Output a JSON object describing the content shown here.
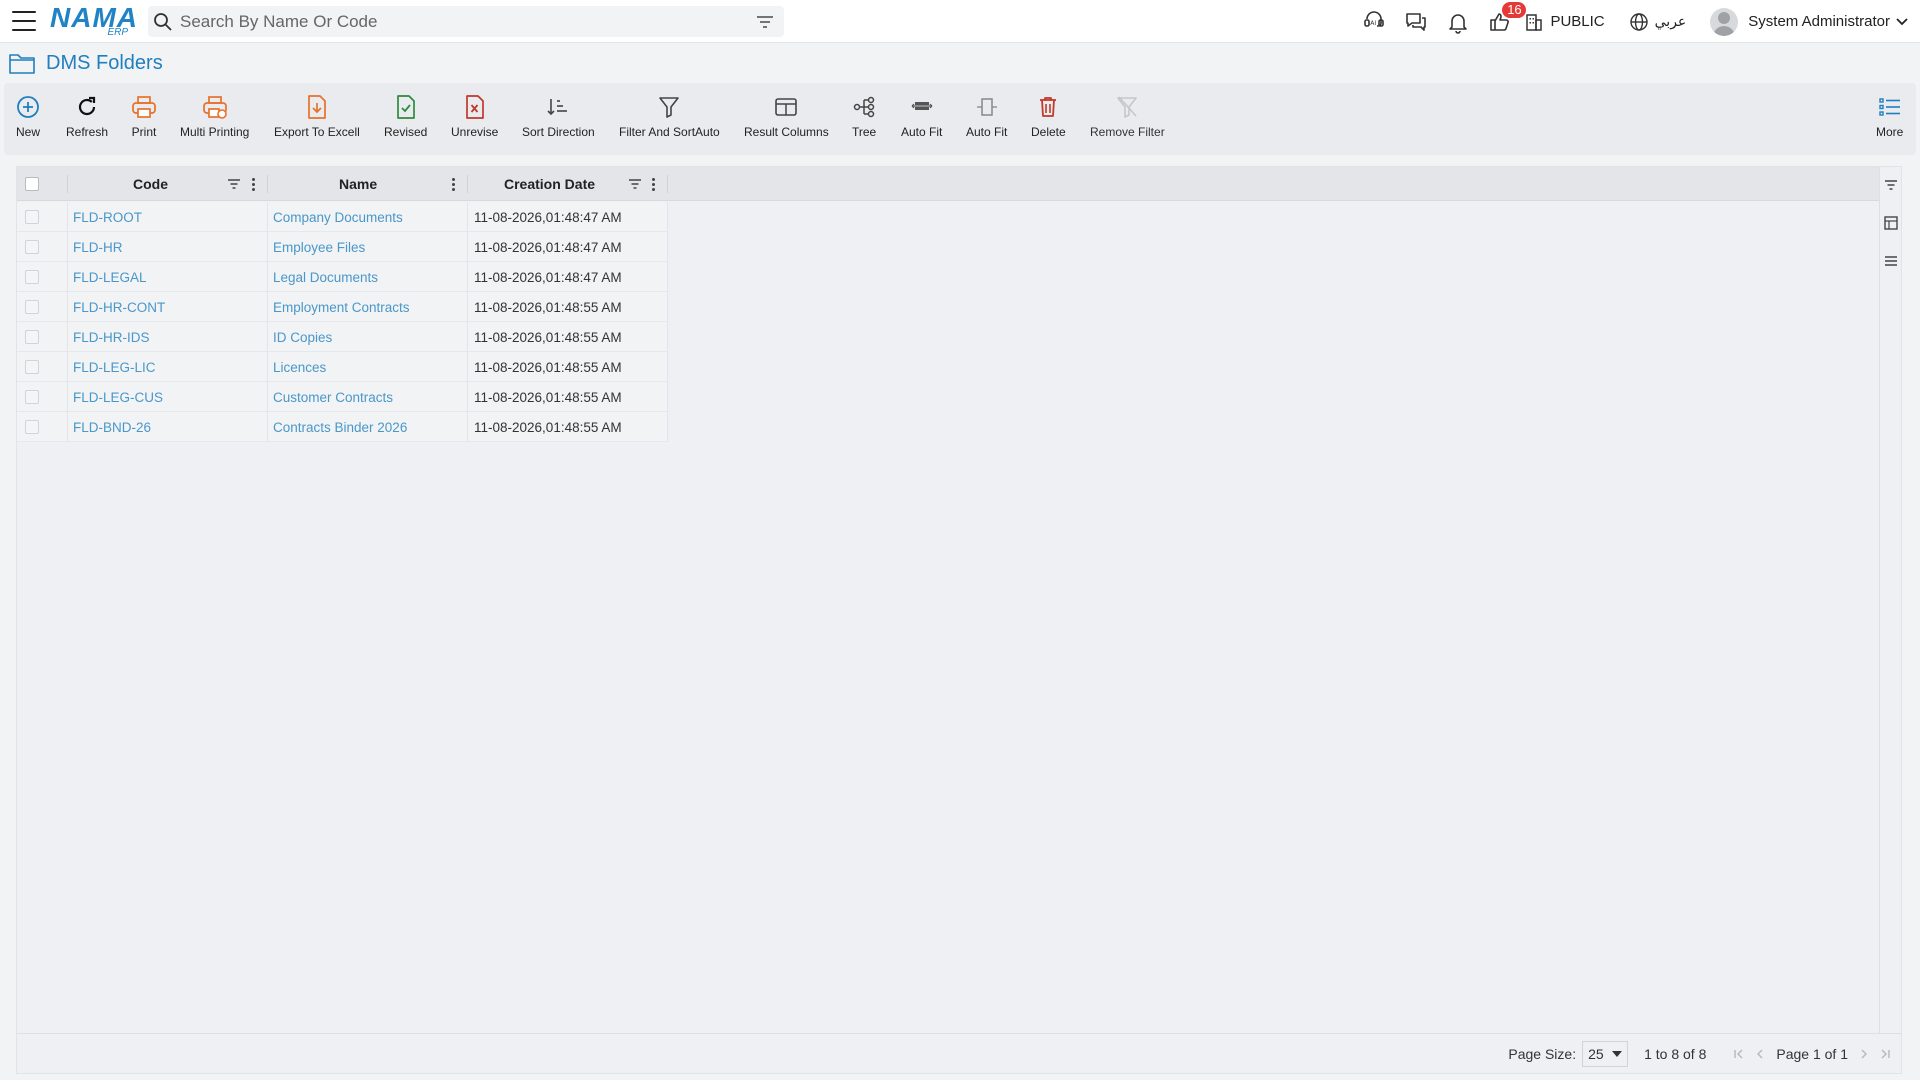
{
  "header": {
    "logo_main": "NAMA",
    "logo_sub": "ERP",
    "search_placeholder": "Search By Name Or Code",
    "notification_count": "16",
    "branch": "PUBLIC",
    "language": "عربي",
    "user_name": "System Administrator"
  },
  "page": {
    "title": "DMS Folders"
  },
  "toolbar": {
    "new": "New",
    "refresh": "Refresh",
    "print": "Print",
    "multi_printing": "Multi Printing",
    "export_excel": "Export To Excell",
    "revised": "Revised",
    "unrevise": "Unrevise",
    "sort_direction": "Sort Direction",
    "filter_sort_auto": "Filter And SortAuto",
    "result_columns": "Result Columns",
    "tree": "Tree",
    "auto_fit_1": "Auto Fit",
    "auto_fit_2": "Auto Fit",
    "delete": "Delete",
    "remove_filter": "Remove Filter",
    "more": "More"
  },
  "grid": {
    "columns": {
      "code": "Code",
      "name": "Name",
      "creation_date": "Creation Date"
    },
    "rows": [
      {
        "code": "FLD-ROOT",
        "name": "Company Documents",
        "date": "11-08-2026,01:48:47 AM"
      },
      {
        "code": "FLD-HR",
        "name": "Employee Files",
        "date": "11-08-2026,01:48:47 AM"
      },
      {
        "code": "FLD-LEGAL",
        "name": "Legal Documents",
        "date": "11-08-2026,01:48:47 AM"
      },
      {
        "code": "FLD-HR-CONT",
        "name": "Employment Contracts",
        "date": "11-08-2026,01:48:55 AM"
      },
      {
        "code": "FLD-HR-IDS",
        "name": "ID Copies",
        "date": "11-08-2026,01:48:55 AM"
      },
      {
        "code": "FLD-LEG-LIC",
        "name": "Licences",
        "date": "11-08-2026,01:48:55 AM"
      },
      {
        "code": "FLD-LEG-CUS",
        "name": "Customer Contracts",
        "date": "11-08-2026,01:48:55 AM"
      },
      {
        "code": "FLD-BND-26",
        "name": "Contracts Binder 2026",
        "date": "11-08-2026,01:48:55 AM"
      }
    ]
  },
  "pager": {
    "page_size_label": "Page Size:",
    "page_size": "25",
    "count": "1 to 8 of 8",
    "page_label": "Page 1 of 1"
  },
  "colors": {
    "accent": "#1f7fbf",
    "link": "#4a97c9",
    "badge": "#e53935",
    "orange": "#e8712b",
    "green": "#2e8b3e",
    "red": "#c0392b"
  }
}
